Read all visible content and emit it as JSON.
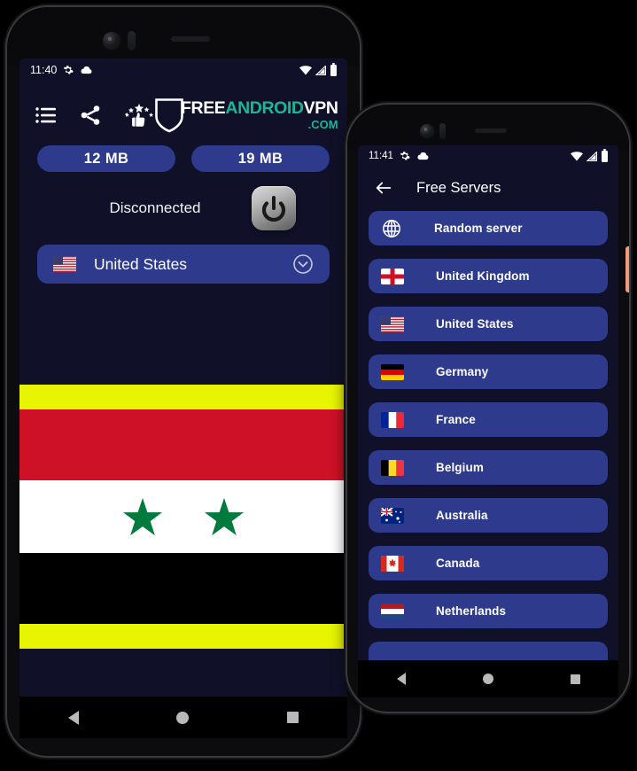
{
  "page": {
    "background_color": "#000000",
    "app_background": "#101129",
    "accent_blue": "#2e3a8c",
    "brand_teal": "#17b79a"
  },
  "phone_primary": {
    "status_bar": {
      "time": "11:40",
      "icons_left": [
        "gear-icon",
        "cloud-icon"
      ],
      "icons_right": [
        "wifi-icon",
        "signal-icon",
        "battery-icon"
      ]
    },
    "toolbar": {
      "icons": [
        {
          "name": "menu-list-icon",
          "label": "Menu"
        },
        {
          "name": "share-icon",
          "label": "Share"
        },
        {
          "name": "rate-us-icon",
          "label": "Rate us"
        }
      ],
      "logo": {
        "part_free": "FREE",
        "part_android": "ANDROID",
        "part_vpn": "VPN",
        "part_com": ".COM",
        "shield_icon": "shield-icon"
      }
    },
    "usage": {
      "download_label": "12 MB",
      "upload_label": "19 MB"
    },
    "connection": {
      "status_text": "Disconnected",
      "power_button_icon": "power-icon"
    },
    "country_selector": {
      "flag": "us-flag",
      "name": "United States",
      "chevron_icon": "chevron-down-icon"
    },
    "banner": {
      "type": "syria-flag-ad",
      "band_color": "#e8f500",
      "flag_red": "#ce1126",
      "flag_white": "#ffffff",
      "flag_black": "#000000",
      "star_color": "#007a3d",
      "star_count": 2
    },
    "nav_bar": {
      "back_icon": "back-triangle-icon",
      "home_icon": "home-circle-icon",
      "recents_icon": "recents-square-icon"
    }
  },
  "phone_secondary": {
    "status_bar": {
      "time": "11:41",
      "icons_left": [
        "gear-icon",
        "cloud-icon"
      ],
      "icons_right": [
        "wifi-icon",
        "signal-icon",
        "battery-icon"
      ]
    },
    "header": {
      "back_icon": "arrow-left-icon",
      "title": "Free Servers"
    },
    "servers": [
      {
        "label": "Random server",
        "flag": "globe-icon"
      },
      {
        "label": "United Kingdom",
        "flag": "uk-flag"
      },
      {
        "label": "United States",
        "flag": "us-flag"
      },
      {
        "label": "Germany",
        "flag": "de-flag"
      },
      {
        "label": "France",
        "flag": "fr-flag"
      },
      {
        "label": "Belgium",
        "flag": "be-flag"
      },
      {
        "label": "Australia",
        "flag": "au-flag"
      },
      {
        "label": "Canada",
        "flag": "ca-flag"
      },
      {
        "label": "Netherlands",
        "flag": "nl-flag"
      },
      {
        "label": "",
        "flag": ""
      }
    ],
    "nav_bar": {
      "back_icon": "back-triangle-icon",
      "home_icon": "home-circle-icon",
      "recents_icon": "recents-square-icon"
    },
    "side_button_color": "#f29b7e"
  }
}
